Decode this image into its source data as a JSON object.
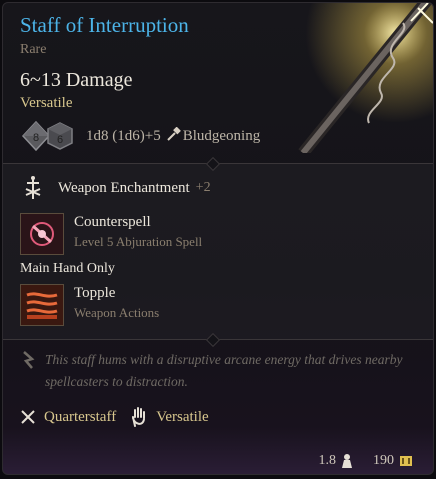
{
  "item": {
    "name": "Staff of Interruption",
    "rarity": "Rare",
    "damage": "6~13 Damage",
    "property": "Versatile",
    "dice": [
      "8",
      "6"
    ],
    "damage_formula": "1d8 (1d6)+5",
    "damage_type": "Bludgeoning"
  },
  "enchantment": {
    "label": "Weapon Enchantment",
    "bonus": "+2"
  },
  "abilities": [
    {
      "name": "Counterspell",
      "subtitle": "Level 5 Abjuration Spell",
      "icon": "counterspell-icon"
    },
    {
      "name": "Topple",
      "subtitle": "Weapon Actions",
      "icon": "topple-icon"
    }
  ],
  "main_hand_note": "Main Hand Only",
  "flavor_text": "This staff hums with a disruptive arcane energy that drives nearby spellcasters to distraction.",
  "tags": [
    {
      "label": "Quarterstaff",
      "icon": "crossed-staves-icon"
    },
    {
      "label": "Versatile",
      "icon": "hand-icon"
    }
  ],
  "footer": {
    "weight": "1.8",
    "weight_icon": "weight-icon",
    "value": "190",
    "value_icon": "gold-icon"
  },
  "colors": {
    "title": "#4cb4e8",
    "gold_text": "#d8c78e",
    "muted": "#8a7e6e"
  }
}
